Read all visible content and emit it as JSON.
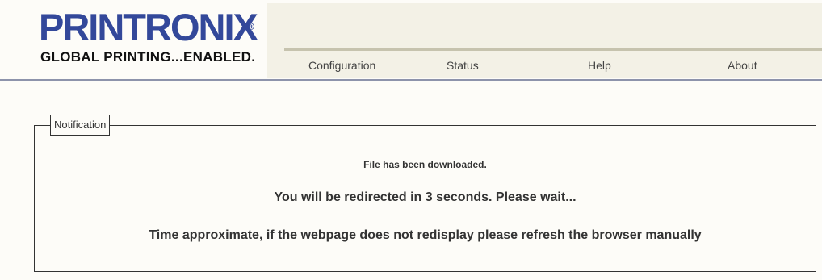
{
  "brand": {
    "logo_text": "PRINTRONIX",
    "registered_mark": "®",
    "tagline": "GLOBAL PRINTING...ENABLED.",
    "logo_color": "#33489a"
  },
  "nav": {
    "items": [
      {
        "label": "Configuration"
      },
      {
        "label": "Status"
      },
      {
        "label": "Help"
      },
      {
        "label": "About"
      }
    ]
  },
  "notification": {
    "legend": "Notification",
    "download_message": "File has been downloaded.",
    "redirect_message": "You will be redirected in 3 seconds. Please wait...",
    "time_message": "Time approximate, if the webpage does not redisplay please refresh the browser manually"
  }
}
